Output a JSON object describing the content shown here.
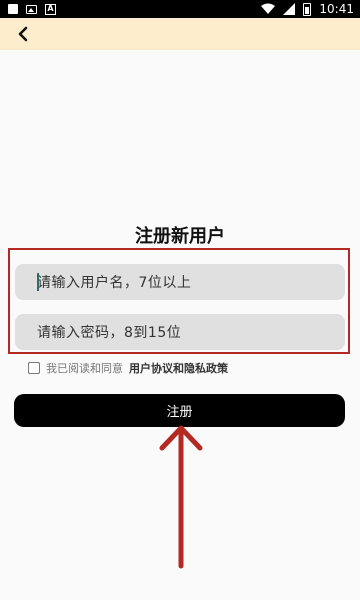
{
  "status_bar": {
    "time": "10:41"
  },
  "app_bar": {
    "back_icon": "chevron-left-icon"
  },
  "title": "注册新用户",
  "form": {
    "username_placeholder": "请输入用户名，7位以上",
    "password_placeholder": "请输入密码，8到15位"
  },
  "agreement": {
    "prefix": "我已阅读和同意",
    "links": "用户协议和隐私政策"
  },
  "register_button_label": "注册",
  "colors": {
    "app_bar_bg": "#fdedcc",
    "highlight_border": "#b22a22",
    "arrow": "#b22a22",
    "button_bg": "#000000",
    "input_bg": "#e0e0e0"
  }
}
